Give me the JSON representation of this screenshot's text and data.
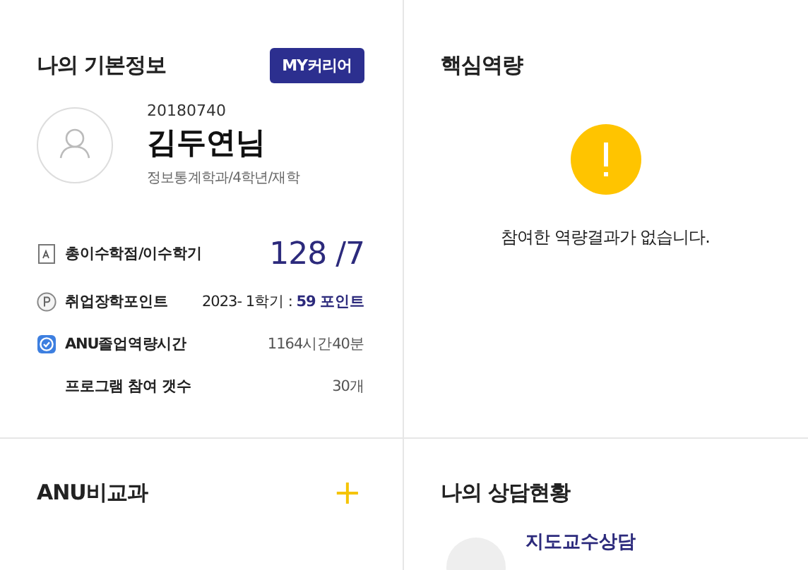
{
  "profile": {
    "title": "나의 기본정보",
    "career_button": "MY커리어",
    "student_id": "20180740",
    "name": "김두연님",
    "department": "정보통계학과/4학년/재학",
    "stats": [
      {
        "kind": "document",
        "label": "총이수학점/이수학기",
        "value": "128 /7"
      },
      {
        "kind": "coin",
        "label": "취업장학포인트",
        "value": "2023- 1학기 : **59 포인트**"
      },
      {
        "kind": "check",
        "label": "ANU졸업역량시간",
        "value": "1164시간40분"
      },
      {
        "kind": "none",
        "label": "프로그램 참여 갯수",
        "value": "30개"
      }
    ]
  },
  "competency": {
    "title": "핵심역량",
    "empty_message": "참여한 역량결과가 없습니다."
  },
  "extracurricular": {
    "title": "ANU비교과",
    "add_button": "+"
  },
  "counseling": {
    "title": "나의 상담현황",
    "items": [
      {
        "title": "지도교수상담"
      }
    ]
  }
}
